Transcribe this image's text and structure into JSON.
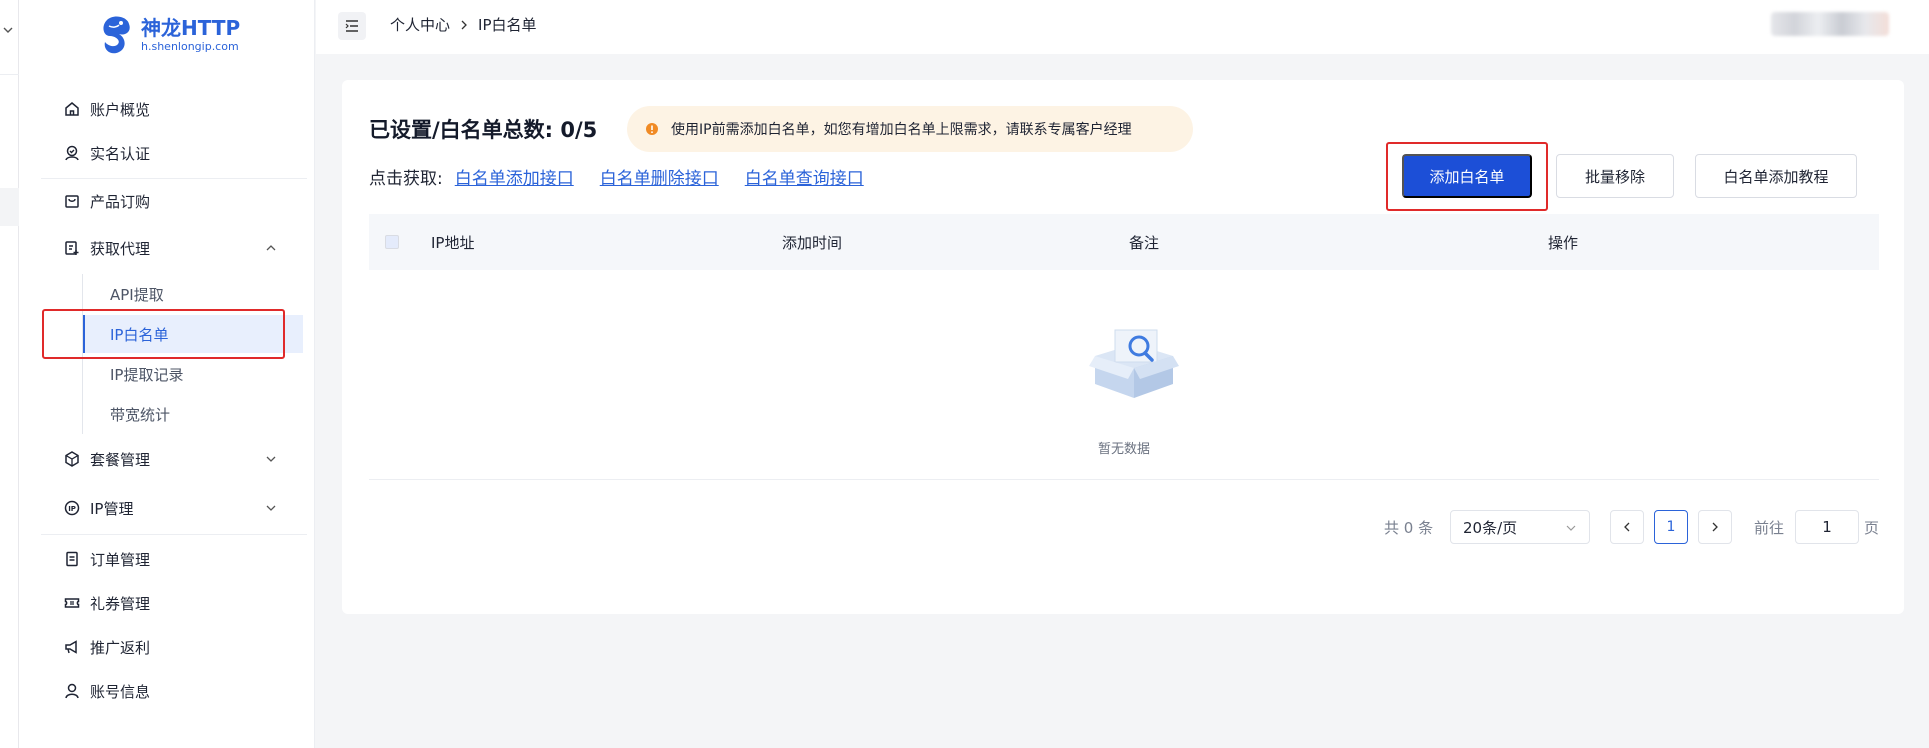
{
  "brand": {
    "name": "神龙HTTP",
    "domain": "h.shenlongip.com",
    "color": "#2b63d9"
  },
  "sidebar": {
    "items": [
      {
        "label": "账户概览",
        "icon": "home-icon"
      },
      {
        "label": "实名认证",
        "icon": "id-verify-icon"
      },
      {
        "label": "产品订购",
        "icon": "shopping-icon"
      },
      {
        "label": "获取代理",
        "icon": "proxy-icon"
      },
      {
        "label": "套餐管理",
        "icon": "package-icon"
      },
      {
        "label": "IP管理",
        "icon": "ip-icon"
      },
      {
        "label": "订单管理",
        "icon": "order-icon"
      },
      {
        "label": "礼券管理",
        "icon": "coupon-icon"
      },
      {
        "label": "推广返利",
        "icon": "promo-icon"
      },
      {
        "label": "账号信息",
        "icon": "user-icon"
      }
    ],
    "proxy_sub": [
      {
        "label": "API提取"
      },
      {
        "label": "IP白名单",
        "active": true
      },
      {
        "label": "IP提取记录"
      },
      {
        "label": "带宽统计"
      }
    ]
  },
  "header": {
    "breadcrumb": [
      "个人中心",
      "IP白名单"
    ]
  },
  "main": {
    "title": "已设置/白名单总数: 0/5",
    "notice": "使用IP前需添加白名单，如您有增加白名单上限需求，请联系专属客户经理",
    "links_label": "点击获取:",
    "links": [
      "白名单添加接口",
      "白名单删除接口",
      "白名单查询接口"
    ],
    "buttons": {
      "add": "添加白名单",
      "batch_remove": "批量移除",
      "tutorial": "白名单添加教程"
    },
    "table": {
      "columns": [
        "IP地址",
        "添加时间",
        "备注",
        "操作"
      ],
      "empty_text": "暂无数据"
    },
    "pagination": {
      "total": "共 0 条",
      "page_size": "20条/页",
      "current_page": "1",
      "goto_label": "前往",
      "goto_value": "1",
      "page_unit": "页"
    }
  },
  "colors": {
    "primary": "#1c4fd7",
    "notice_bg": "#fdf3e4",
    "warning": "#f08a24",
    "highlight": "#e02a2a"
  }
}
